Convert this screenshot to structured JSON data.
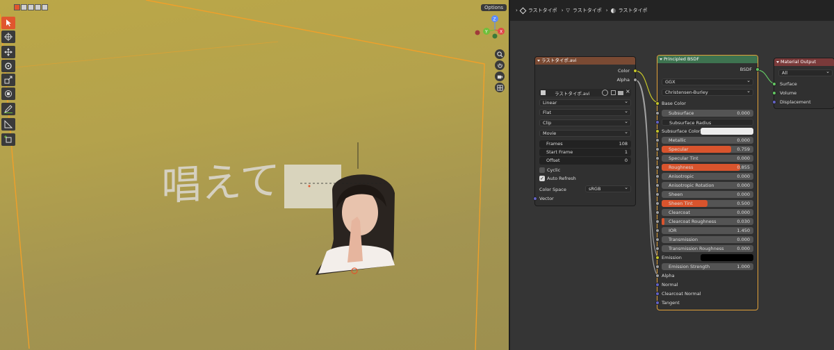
{
  "viewport": {
    "options_label": "Options",
    "headline_text": "唱えて",
    "gizmo": {
      "x": "X",
      "y": "Y",
      "z": "Z"
    }
  },
  "node_editor": {
    "breadcrumbs": [
      "ラストタイポ",
      "ラストタイポ",
      "ラストタイポ"
    ]
  },
  "image_node": {
    "title": "ラストタイポ.avi",
    "outputs": [
      "Color",
      "Alpha"
    ],
    "image_name": "ラストタイポ.avi",
    "dropdowns": [
      "Linear",
      "Flat",
      "Clip",
      "Movie"
    ],
    "frames_label": "Frames",
    "frames_value": "108",
    "start_label": "Start Frame",
    "start_value": "1",
    "offset_label": "Offset",
    "offset_value": "0",
    "cyclic_label": "Cyclic",
    "cyclic": false,
    "auto_refresh_label": "Auto Refresh",
    "auto_refresh": true,
    "color_space_label": "Color Space",
    "color_space_value": "sRGB",
    "vector_label": "Vector"
  },
  "bsdf_node": {
    "title": "Principled BSDF",
    "output": "BSDF",
    "distribution": "GGX",
    "subsurface_method": "Christensen-Burley",
    "base_color_label": "Base Color",
    "fields": [
      {
        "label": "Subsurface",
        "value": "0.000"
      },
      {
        "label": "Subsurface Radius",
        "value": ""
      },
      {
        "label": "Subsurface Color",
        "value": ""
      },
      {
        "label": "Metallic",
        "value": "0.000"
      },
      {
        "label": "Specular",
        "value": "0.759",
        "fill": 0.759
      },
      {
        "label": "Specular Tint",
        "value": "0.000"
      },
      {
        "label": "Roughness",
        "value": "0.855",
        "fill": 0.855
      },
      {
        "label": "Anisotropic",
        "value": "0.000"
      },
      {
        "label": "Anisotropic Rotation",
        "value": "0.000"
      },
      {
        "label": "Sheen",
        "value": "0.000"
      },
      {
        "label": "Sheen Tint",
        "value": "0.500",
        "fill": 0.5
      },
      {
        "label": "Clearcoat",
        "value": "0.000"
      },
      {
        "label": "Clearcoat Roughness",
        "value": "0.030",
        "fill": 0.03
      },
      {
        "label": "IOR",
        "value": "1.450"
      },
      {
        "label": "Transmission",
        "value": "0.000"
      },
      {
        "label": "Transmission Roughness",
        "value": "0.000"
      },
      {
        "label": "Emission",
        "value": ""
      },
      {
        "label": "Emission Strength",
        "value": "1.000"
      }
    ],
    "inputs_tail": [
      "Alpha",
      "Normal",
      "Clearcoat Normal",
      "Tangent"
    ]
  },
  "output_node": {
    "title": "Material Output",
    "target": "All",
    "inputs": [
      "Surface",
      "Volume",
      "Displacement"
    ]
  },
  "colors": {
    "accent": "#e0562e",
    "image_header": "#7a4a33",
    "bsdf_header": "#3e7350",
    "output_header": "#7a3a3a",
    "socket_yellow": "#c7c729",
    "socket_grey": "#a1a1a1",
    "socket_purple": "#6363c7",
    "socket_green": "#63c763"
  }
}
